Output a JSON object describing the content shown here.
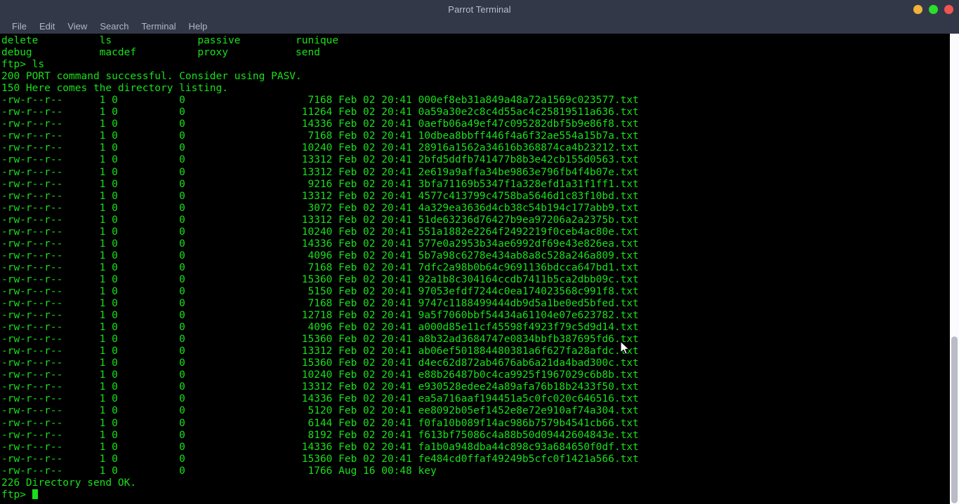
{
  "window": {
    "title": "Parrot Terminal",
    "controls": [
      {
        "name": "minimize-button",
        "label": "minimize",
        "color": "#f1b33c"
      },
      {
        "name": "maximize-button",
        "label": "maximize",
        "color": "#2ae02a"
      },
      {
        "name": "close-button",
        "label": "close",
        "color": "#f0564f"
      }
    ]
  },
  "menubar": {
    "items": [
      {
        "label": "File",
        "name": "menu-file"
      },
      {
        "label": "Edit",
        "name": "menu-edit"
      },
      {
        "label": "View",
        "name": "menu-view"
      },
      {
        "label": "Search",
        "name": "menu-search"
      },
      {
        "label": "Terminal",
        "name": "menu-terminal"
      },
      {
        "label": "Help",
        "name": "menu-help"
      }
    ]
  },
  "terminal": {
    "foreground_color": "#18e01a",
    "background_color": "#000000",
    "help_columns_row1": [
      "delete",
      "ls",
      "passive",
      "runique"
    ],
    "help_columns_row2": [
      "debug",
      "macdef",
      "proxy",
      "send"
    ],
    "prompt": "ftp>",
    "command": "ls",
    "responses": {
      "port": "200 PORT command successful. Consider using PASV.",
      "listing_start": "150 Here comes the directory listing.",
      "listing_end": "226 Directory send OK."
    },
    "listing_permissions": "-rw-r--r--",
    "listing_links": "1",
    "listing_owner": "0",
    "listing_group": "0",
    "files": [
      {
        "size": "7168",
        "month": "Feb",
        "day": "02",
        "time": "20:41",
        "name": "000ef8eb31a849a48a72a1569c023577.txt"
      },
      {
        "size": "11264",
        "month": "Feb",
        "day": "02",
        "time": "20:41",
        "name": "0a59a30e2c8c4d55ac4c25819511a636.txt"
      },
      {
        "size": "14336",
        "month": "Feb",
        "day": "02",
        "time": "20:41",
        "name": "0aefb06a49ef47c095282dbf5b9e86f8.txt"
      },
      {
        "size": "7168",
        "month": "Feb",
        "day": "02",
        "time": "20:41",
        "name": "10dbea8bbff446f4a6f32ae554a15b7a.txt"
      },
      {
        "size": "10240",
        "month": "Feb",
        "day": "02",
        "time": "20:41",
        "name": "28916a1562a34616b368874ca4b23212.txt"
      },
      {
        "size": "13312",
        "month": "Feb",
        "day": "02",
        "time": "20:41",
        "name": "2bfd5ddfb741477b8b3e42cb155d0563.txt"
      },
      {
        "size": "13312",
        "month": "Feb",
        "day": "02",
        "time": "20:41",
        "name": "2e619a9affa34be9863e796fb4f4b07e.txt"
      },
      {
        "size": "9216",
        "month": "Feb",
        "day": "02",
        "time": "20:41",
        "name": "3bfa71169b5347f1a328efd1a31f1ff1.txt"
      },
      {
        "size": "13312",
        "month": "Feb",
        "day": "02",
        "time": "20:41",
        "name": "4577c413799c4758ba5646d1c83f10bd.txt"
      },
      {
        "size": "3072",
        "month": "Feb",
        "day": "02",
        "time": "20:41",
        "name": "4a329ea3636d4cb38c54b194c177abb9.txt"
      },
      {
        "size": "13312",
        "month": "Feb",
        "day": "02",
        "time": "20:41",
        "name": "51de63236d76427b9ea97206a2a2375b.txt"
      },
      {
        "size": "10240",
        "month": "Feb",
        "day": "02",
        "time": "20:41",
        "name": "551a1882e2264f2492219f0ceb4ac80e.txt"
      },
      {
        "size": "14336",
        "month": "Feb",
        "day": "02",
        "time": "20:41",
        "name": "577e0a2953b34ae6992df69e43e826ea.txt"
      },
      {
        "size": "4096",
        "month": "Feb",
        "day": "02",
        "time": "20:41",
        "name": "5b7a98c6278e434ab8a8c528a246a809.txt"
      },
      {
        "size": "7168",
        "month": "Feb",
        "day": "02",
        "time": "20:41",
        "name": "7dfc2a98b0b64c9691136bdcca647bd1.txt"
      },
      {
        "size": "15360",
        "month": "Feb",
        "day": "02",
        "time": "20:41",
        "name": "92a1b8c304164ccdb7411b5ca2dbb09c.txt"
      },
      {
        "size": "5150",
        "month": "Feb",
        "day": "02",
        "time": "20:41",
        "name": "97053efdf7244c0ea174023568c991f8.txt"
      },
      {
        "size": "7168",
        "month": "Feb",
        "day": "02",
        "time": "20:41",
        "name": "9747c1188499444db9d5a1be0ed5bfed.txt"
      },
      {
        "size": "12718",
        "month": "Feb",
        "day": "02",
        "time": "20:41",
        "name": "9a5f7060bbf54434a61104e07e623782.txt"
      },
      {
        "size": "4096",
        "month": "Feb",
        "day": "02",
        "time": "20:41",
        "name": "a000d85e11cf45598f4923f79c5d9d14.txt"
      },
      {
        "size": "15360",
        "month": "Feb",
        "day": "02",
        "time": "20:41",
        "name": "a8b32ad3684747e0834bbfb387695fd6.txt"
      },
      {
        "size": "13312",
        "month": "Feb",
        "day": "02",
        "time": "20:41",
        "name": "ab06ef501884480381a6f627fa28afdc.txt"
      },
      {
        "size": "15360",
        "month": "Feb",
        "day": "02",
        "time": "20:41",
        "name": "d4ec62d872ab4676ab6a21da4bad300c.txt"
      },
      {
        "size": "10240",
        "month": "Feb",
        "day": "02",
        "time": "20:41",
        "name": "e88b26487b0c4ca9925f1967029c6b8b.txt"
      },
      {
        "size": "13312",
        "month": "Feb",
        "day": "02",
        "time": "20:41",
        "name": "e930528edee24a89afa76b18b2433f50.txt"
      },
      {
        "size": "14336",
        "month": "Feb",
        "day": "02",
        "time": "20:41",
        "name": "ea5a716aaf194451a5c0fc020c646516.txt"
      },
      {
        "size": "5120",
        "month": "Feb",
        "day": "02",
        "time": "20:41",
        "name": "ee8092b05ef1452e8e72e910af74a304.txt"
      },
      {
        "size": "6144",
        "month": "Feb",
        "day": "02",
        "time": "20:41",
        "name": "f0fa10b089f14ac986b7579b4541cb66.txt"
      },
      {
        "size": "8192",
        "month": "Feb",
        "day": "02",
        "time": "20:41",
        "name": "f613bf75086c4a88b50d09442604843e.txt"
      },
      {
        "size": "14336",
        "month": "Feb",
        "day": "02",
        "time": "20:41",
        "name": "fa1b0a948dba44c898c93a684650f0df.txt"
      },
      {
        "size": "15360",
        "month": "Feb",
        "day": "02",
        "time": "20:41",
        "name": "fe484cd0ffaf49249b5cfc0f1421a566.txt"
      },
      {
        "size": "1766",
        "month": "Aug",
        "day": "16",
        "time": "00:48",
        "name": "key"
      }
    ]
  },
  "scrollbar": {
    "name": "terminal-scrollbar"
  }
}
